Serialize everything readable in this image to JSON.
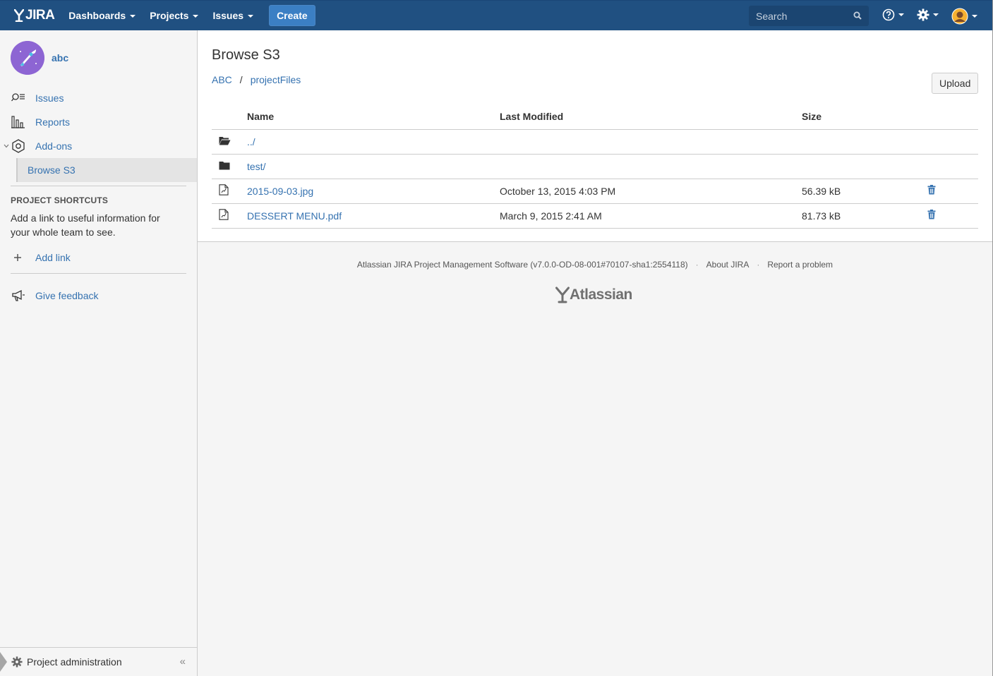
{
  "header": {
    "logo": "JIRA",
    "nav": [
      {
        "label": "Dashboards"
      },
      {
        "label": "Projects"
      },
      {
        "label": "Issues"
      }
    ],
    "create_label": "Create",
    "search_placeholder": "Search",
    "brand_color": "#205081"
  },
  "sidebar": {
    "project_name": "abc",
    "items": [
      {
        "label": "Issues"
      },
      {
        "label": "Reports"
      },
      {
        "label": "Add-ons"
      }
    ],
    "sub_item": "Browse S3",
    "shortcuts_heading": "PROJECT SHORTCUTS",
    "shortcuts_text": "Add a link to useful information for your whole team to see.",
    "add_link": "Add link",
    "feedback": "Give feedback",
    "admin": "Project administration",
    "collapse": "«"
  },
  "main": {
    "title": "Browse S3",
    "breadcrumb": [
      "ABC",
      "projectFiles"
    ],
    "breadcrumb_sep": "/",
    "upload_label": "Upload",
    "columns": [
      "Name",
      "Last Modified",
      "Size"
    ],
    "rows": [
      {
        "icon": "folder-open-icon",
        "name": "../",
        "modified": "",
        "size": ""
      },
      {
        "icon": "folder-icon",
        "name": "test/",
        "modified": "",
        "size": ""
      },
      {
        "icon": "file-icon",
        "name": "2015-09-03.jpg",
        "modified": "October 13, 2015 4:03 PM",
        "size": "56.39 kB"
      },
      {
        "icon": "file-icon",
        "name": "DESSERT MENU.pdf",
        "modified": "March 9, 2015 2:41 AM",
        "size": "81.73 kB"
      }
    ]
  },
  "footer": {
    "software": "Atlassian JIRA Project Management Software (v7.0.0-OD-08-001#70107-sha1:2554118)",
    "about": "About JIRA",
    "report": "Report a problem",
    "logo": "Atlassian"
  }
}
